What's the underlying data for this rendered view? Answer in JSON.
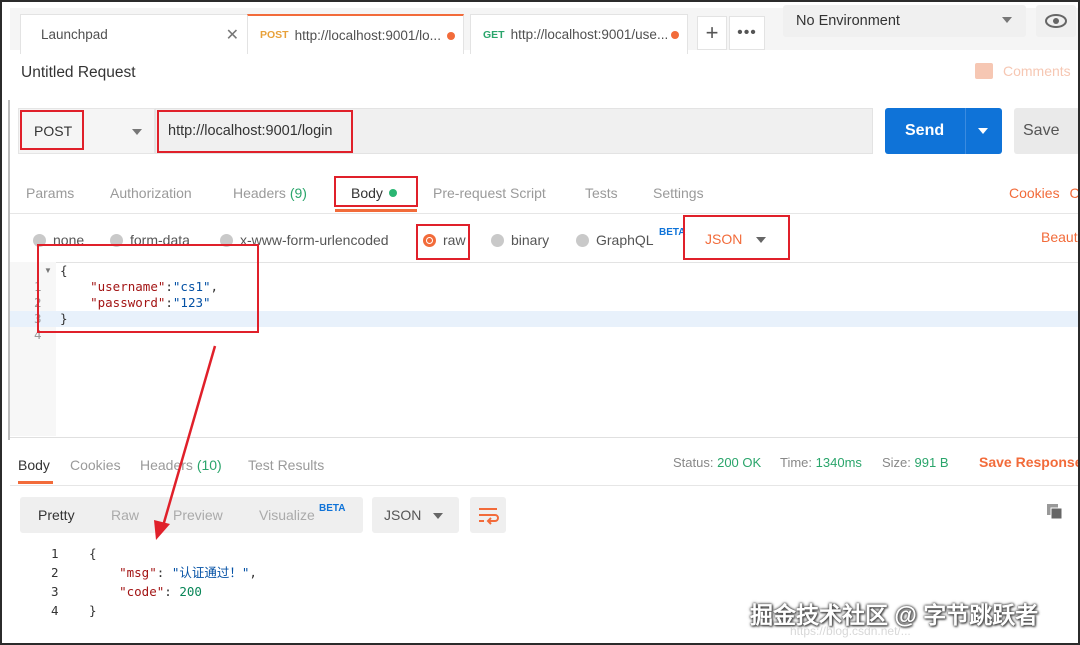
{
  "tabs": [
    {
      "label": "Launchpad"
    },
    {
      "method": "POST",
      "label": "http://localhost:9001/lo..."
    },
    {
      "method": "GET",
      "label": "http://localhost:9001/use..."
    }
  ],
  "environment": {
    "selected": "No Environment"
  },
  "request": {
    "title": "Untitled Request",
    "comments_label": "Comments",
    "method": "POST",
    "url": "http://localhost:9001/login",
    "send_label": "Send",
    "save_label": "Save"
  },
  "request_tabs": {
    "params": "Params",
    "authorization": "Authorization",
    "headers": "Headers",
    "headers_count": "(9)",
    "body": "Body",
    "prerequest": "Pre-request Script",
    "tests": "Tests",
    "settings": "Settings",
    "cookies": "Cookies",
    "cookies_tail": "C"
  },
  "body_types": {
    "none": "none",
    "form_data": "form-data",
    "urlencoded": "x-www-form-urlencoded",
    "raw": "raw",
    "binary": "binary",
    "graphql": "GraphQL",
    "beta": "BETA",
    "format": "JSON",
    "beautify": "Beaut"
  },
  "request_body": {
    "line_numbers": [
      "1",
      "2",
      "3",
      "4"
    ],
    "lines": [
      "{",
      "    \"username\":\"cs1\",",
      "    \"password\":\"123\"",
      "}"
    ],
    "key1": "\"username\"",
    "val1": "\"cs1\"",
    "key2": "\"password\"",
    "val2": "\"123\""
  },
  "response_tabs": {
    "body": "Body",
    "cookies": "Cookies",
    "headers": "Headers",
    "headers_count": "(10)",
    "test_results": "Test Results"
  },
  "response_status": {
    "status_label": "Status:",
    "status_value": "200 OK",
    "time_label": "Time:",
    "time_value": "1340ms",
    "size_label": "Size:",
    "size_value": "991 B",
    "save_response": "Save Response"
  },
  "response_view": {
    "pretty": "Pretty",
    "raw": "Raw",
    "preview": "Preview",
    "visualize": "Visualize",
    "beta": "BETA",
    "format": "JSON"
  },
  "response_body": {
    "line_numbers": [
      "1",
      "2",
      "3",
      "4"
    ],
    "key1": "\"msg\"",
    "val1": "\"认证通过！\"",
    "key2": "\"code\"",
    "val2": "200"
  },
  "watermark": {
    "text": "掘金技术社区 @ 字节跳跃者",
    "url": "https://blog.csdn.net/..."
  },
  "colors": {
    "accent": "#f26b3a",
    "send_blue": "#0f73d8",
    "annotation_red": "#e0202a",
    "success_green": "#2aa56b"
  }
}
